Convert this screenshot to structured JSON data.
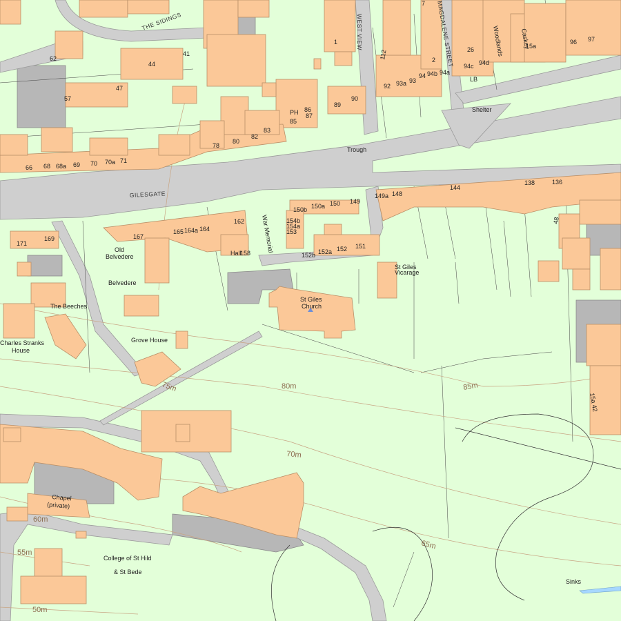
{
  "colors": {
    "background": "#e3ffd9",
    "building": "#fbc898",
    "road": "#cfcfcf",
    "gray_area": "#b7b7b7",
    "contour": "#c8a583",
    "church_marker": "#6f8fd8"
  },
  "roads": {
    "gilesgate": "GILESGATE",
    "the_sidings": "THE SIDINGS",
    "west_view": "WEST VIEW",
    "magdalene_street": "MAGDALENE STREET"
  },
  "places": {
    "trough": "Trough",
    "shelter": "Shelter",
    "lb": "LB",
    "ph": "PH",
    "woodlands": "Woodlands",
    "caskey": "Caskey",
    "old_belvedere_1": "Old",
    "old_belvedere_2": "Belvedere",
    "belvedere": "Belvedere",
    "the_beeches": "The Beeches",
    "charles_stranks_1": "Charles Stranks",
    "charles_stranks_2": "House",
    "grove_house": "Grove House",
    "war_memorial": "War Memorial",
    "hall": "Hall",
    "st_giles_church_1": "St Giles",
    "st_giles_church_2": "Church",
    "st_giles_vicarage_1": "St Giles",
    "st_giles_vicarage_2": "Vicarage",
    "chapel_1": "Chapel",
    "chapel_2": "(private)",
    "college_1": "College of St Hild",
    "college_2": "& St Bede",
    "sinks": "Sinks"
  },
  "contours": {
    "c80": "80m",
    "c85": "85m",
    "c75": "75m",
    "c70": "70m",
    "c65": "65m",
    "c60": "60m",
    "c55": "55m",
    "c50": "50m"
  },
  "house_numbers": {
    "n62": "62",
    "n44": "44",
    "n41": "41",
    "n47": "47",
    "n57": "57",
    "n66": "66",
    "n68": "68",
    "n68a": "68a",
    "n69": "69",
    "n70": "70",
    "n70a": "70a",
    "n71": "71",
    "n78": "78",
    "n80": "80",
    "n82": "82",
    "n83": "83",
    "n85": "85",
    "n86": "86",
    "n87": "87",
    "n89": "89",
    "n90": "90",
    "n92": "92",
    "n93a": "93a",
    "n93": "93",
    "n94": "94",
    "n94b": "94b",
    "n94a": "94a",
    "n94c": "94c",
    "n94d": "94d",
    "n96": "96",
    "n97": "97",
    "n112": "112",
    "n2": "2",
    "n7": "7",
    "n26": "26",
    "n1": "1",
    "n15a": "15a",
    "n144": "144",
    "n138": "138",
    "n136": "136",
    "n149a": "149a",
    "n148": "148",
    "n150b": "150b",
    "n150a": "150a",
    "n150": "150",
    "n149": "149",
    "n154b": "154b",
    "n154a": "154a",
    "n153": "153",
    "n152b": "152b",
    "n152a": "152a",
    "n152": "152",
    "n151": "151",
    "n171": "171",
    "n169": "169",
    "n167": "167",
    "n165": "165",
    "n164a": "164a",
    "n164": "164",
    "n162": "162",
    "n158": "158",
    "n48": "48",
    "n15a42": "15a 42"
  }
}
